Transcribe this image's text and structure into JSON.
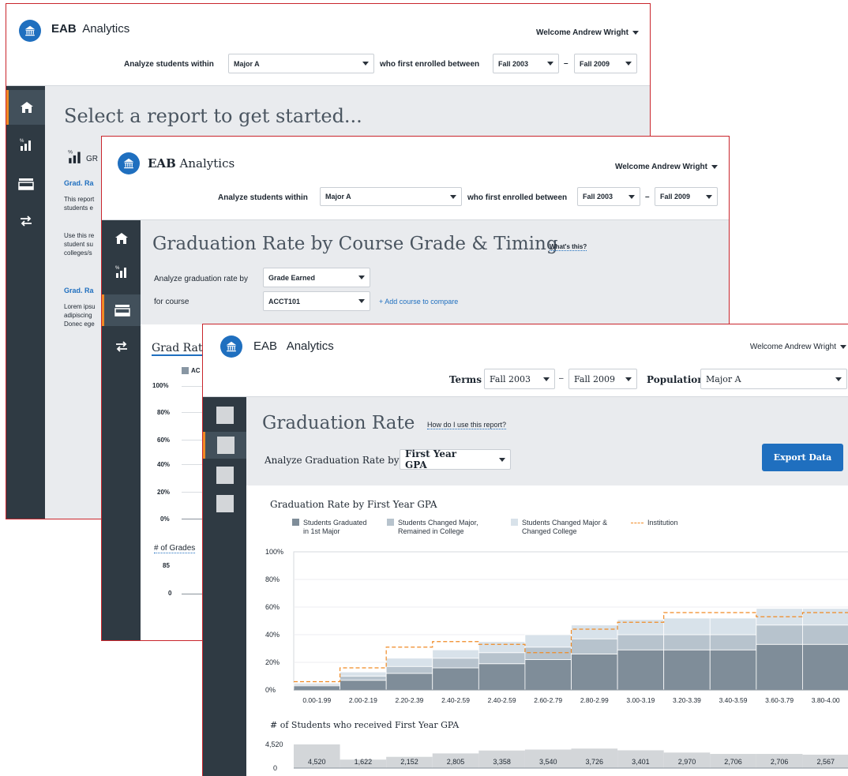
{
  "brand": {
    "bold": "EAB",
    "rest": "Analytics"
  },
  "w1": {
    "welcome": "Welcome Andrew Wright",
    "analyze_label": "Analyze students within",
    "major_value": "Major A",
    "enrolled_label": "who first enrolled between",
    "from_value": "Fall 2003",
    "dash": "–",
    "to_value": "Fall 2009",
    "heading": "Select a report to get started...",
    "section_label": "GR",
    "item1_title": "Grad. Ra",
    "item1_desc": [
      "This report",
      "students e"
    ],
    "item1_desc2": [
      "Use this re",
      "student su",
      "colleges/s"
    ],
    "item2_title": "Grad. Ra",
    "item2_desc": [
      "Lorem ipsu",
      "adipiscing",
      "Donec ege"
    ]
  },
  "w2": {
    "welcome": "Welcome Andrew Wright",
    "analyze_label": "Analyze students within",
    "major_value": "Major A",
    "enrolled_label": "who first enrolled between",
    "from_value": "Fall 2003",
    "dash": "–",
    "to_value": "Fall 2009",
    "heading": "Graduation Rate by Course Grade & Timing",
    "whats_this": "What's this?",
    "rate_by_label": "Analyze graduation rate by",
    "rate_by_value": "Grade Earned",
    "course_label": "for course",
    "course_value": "ACCT101",
    "add_course": "+ Add course to compare",
    "chart_title": "Grad Rat",
    "legend_partial": "AC",
    "y_ticks": [
      "100%",
      "80%",
      "60%",
      "40%",
      "20%",
      "0%"
    ],
    "grades_title": "# of Grades",
    "grades_ticks": [
      "85",
      "0"
    ]
  },
  "w3": {
    "welcome": "Welcome Andrew Wright",
    "terms_label": "Terms",
    "from_value": "Fall 2003",
    "dash": "–",
    "to_value": "Fall 2009",
    "population_label": "Population",
    "population_value": "Major A",
    "heading": "Graduation Rate",
    "how_link": "How do I use this report?",
    "analyze_label": "Analyze Graduation Rate by",
    "analyze_value": "First Year GPA",
    "export_button": "Export Data",
    "counts_title": "# of Students who received First Year GPA",
    "counts_ticks": [
      "4,520",
      "0"
    ],
    "counts": [
      "4,520",
      "1,622",
      "2,152",
      "2,805",
      "3,358",
      "3,540",
      "3,726",
      "3,401",
      "2,970",
      "2,706",
      "2,706",
      "2,567"
    ]
  },
  "colors": {
    "accent": "#1f6fbf",
    "sidebar": "#2f3a43",
    "orange": "#f08a24",
    "border": "#c9252c"
  },
  "chart_data": {
    "type": "bar",
    "title": "Graduation Rate by First Year GPA",
    "stacked": true,
    "categories": [
      "0.00-1.99",
      "2.00-2.19",
      "2.20-2.39",
      "2.40-2.59",
      "2.40-2.59",
      "2.60-2.79",
      "2.80-2.99",
      "3.00-3.19",
      "3.20-3.39",
      "3.40-3.59",
      "3.60-3.79",
      "3.80-4.00"
    ],
    "series": [
      {
        "name": "Students Graduated in 1st Major",
        "values": [
          3,
          7,
          12,
          16,
          19,
          22,
          26,
          29,
          29,
          29,
          33,
          33
        ]
      },
      {
        "name": "Students Changed Major, Remained in College",
        "values": [
          1,
          3,
          5,
          7,
          8,
          9,
          11,
          11,
          11,
          11,
          14,
          14
        ]
      },
      {
        "name": "Students Changed Major & Changed College",
        "values": [
          1,
          3,
          6,
          6,
          8,
          9,
          10,
          11,
          12,
          12,
          12,
          12
        ]
      },
      {
        "name": "Institution",
        "type": "line",
        "values": [
          6,
          16,
          31,
          35,
          33,
          27,
          44,
          49,
          56,
          56,
          53,
          56
        ]
      }
    ],
    "legend": [
      {
        "line1": "Students Graduated",
        "line2": "in 1st Major"
      },
      {
        "line1": "Students Changed Major,",
        "line2": "Remained in College"
      },
      {
        "line1": "Students Changed Major &",
        "line2": "Changed College"
      },
      {
        "line1": "Institution",
        "line2": ""
      }
    ],
    "y_ticks": [
      "100%",
      "80%",
      "60%",
      "40%",
      "20%",
      "0%"
    ],
    "ylim": [
      0,
      100
    ],
    "legend_position": "top-left"
  }
}
